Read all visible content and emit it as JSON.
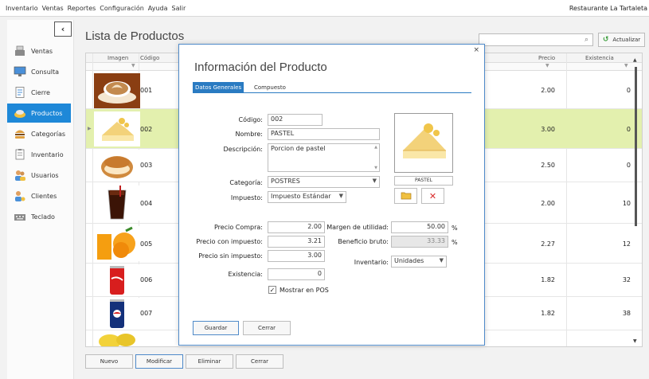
{
  "menu": [
    "Inventario",
    "Ventas",
    "Reportes",
    "Configuración",
    "Ayuda",
    "Salir"
  ],
  "restaurant": "Restaurante La Tartaleta",
  "nav": [
    {
      "label": "Ventas",
      "icon": "register-icon"
    },
    {
      "label": "Consulta",
      "icon": "monitor-icon"
    },
    {
      "label": "Cierre",
      "icon": "document-icon"
    },
    {
      "label": "Productos",
      "icon": "products-icon",
      "active": true
    },
    {
      "label": "Categorías",
      "icon": "burger-icon"
    },
    {
      "label": "Inventario",
      "icon": "clipboard-icon"
    },
    {
      "label": "Usuarios",
      "icon": "users-icon"
    },
    {
      "label": "Clientes",
      "icon": "client-icon"
    },
    {
      "label": "Teclado",
      "icon": "keyboard-icon"
    }
  ],
  "main": {
    "title": "Lista de Productos",
    "refresh": "Actualizar",
    "columns": {
      "image": "Imagen",
      "code": "Código",
      "price": "Precio",
      "stock": "Existencia"
    },
    "rows": [
      {
        "code": "001",
        "price": "2.00",
        "stock": "0",
        "img": "coffee"
      },
      {
        "code": "002",
        "price": "3.00",
        "stock": "0",
        "img": "cake",
        "selected": true
      },
      {
        "code": "003",
        "price": "2.50",
        "stock": "0",
        "img": "bagel"
      },
      {
        "code": "004",
        "price": "2.00",
        "stock": "10",
        "img": "cola-glass"
      },
      {
        "code": "005",
        "price": "2.27",
        "stock": "12",
        "img": "oranges"
      },
      {
        "code": "006",
        "price": "1.82",
        "stock": "32",
        "img": "coke-can"
      },
      {
        "code": "007",
        "price": "1.82",
        "stock": "38",
        "img": "pepsi-can"
      }
    ],
    "buttons": {
      "new": "Nuevo",
      "edit": "Modificar",
      "delete": "Eliminar",
      "close": "Cerrar"
    }
  },
  "modal": {
    "title": "Información del Producto",
    "tabs": [
      "Datos Generales",
      "Compuesto"
    ],
    "labels": {
      "code": "Código:",
      "name": "Nombre:",
      "description": "Descripción:",
      "category": "Categoría:",
      "tax": "Impuesto:",
      "buy_price": "Precio Compra:",
      "price_tax": "Precio con impuesto:",
      "price_notax": "Precio sin impuesto:",
      "stock": "Existencia:",
      "margin": "Margen de utilidad:",
      "gross": "Beneficio bruto:",
      "inventory": "Inventario:",
      "show_pos": "Mostrar en POS"
    },
    "values": {
      "code": "002",
      "name": "PASTEL",
      "description": "Porcion de pastel",
      "category": "POSTRES",
      "tax": "Impuesto Estándar",
      "buy_price": "2.00",
      "price_tax": "3.21",
      "price_notax": "3.00",
      "stock": "0",
      "margin": "50.00",
      "gross": "33.33",
      "inventory": "Unidades"
    },
    "percent": "%",
    "photo_caption": "PASTEL",
    "buttons": {
      "save": "Guardar",
      "close": "Cerrar"
    }
  }
}
